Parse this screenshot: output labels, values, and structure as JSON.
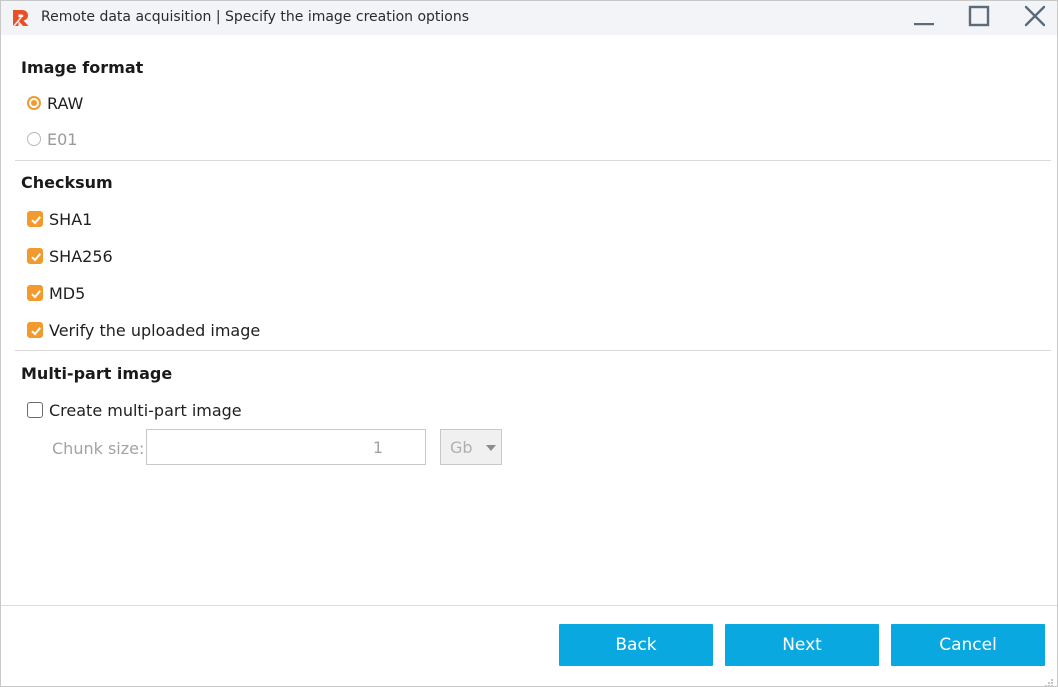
{
  "window": {
    "title": "Remote data acquisition | Specify the image creation options"
  },
  "image_format": {
    "title": "Image format",
    "options": [
      {
        "label": "RAW",
        "selected": true,
        "enabled": true
      },
      {
        "label": "E01",
        "selected": false,
        "enabled": false
      }
    ]
  },
  "checksum": {
    "title": "Checksum",
    "options": [
      {
        "label": "SHA1",
        "checked": true
      },
      {
        "label": "SHA256",
        "checked": true
      },
      {
        "label": "MD5",
        "checked": true
      },
      {
        "label": "Verify the uploaded image",
        "checked": true
      }
    ]
  },
  "multipart": {
    "title": "Multi-part image",
    "create_label": "Create multi-part image",
    "create_checked": false,
    "chunk_label": "Chunk size:",
    "chunk_value": "1",
    "unit": "Gb"
  },
  "footer": {
    "back": "Back",
    "next": "Next",
    "cancel": "Cancel"
  },
  "colors": {
    "accent": "#f39a2e",
    "button": "#0aa8e0",
    "app_icon": "#e8502a"
  },
  "icons": {
    "app": "app-logo-icon",
    "minimize": "minimize-icon",
    "maximize": "maximize-icon",
    "close": "close-icon",
    "check": "checkmark-icon",
    "caret": "caret-down-icon"
  }
}
